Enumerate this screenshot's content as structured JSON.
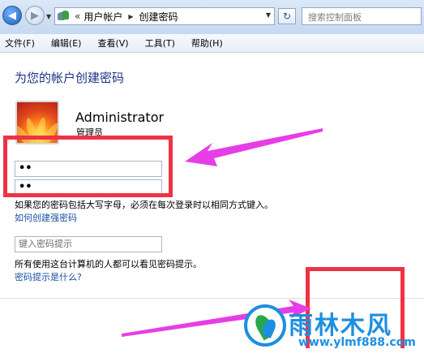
{
  "address_bar": {
    "breadcrumb_prefix": "«",
    "breadcrumb": [
      "用户帐户",
      "创建密码"
    ],
    "search_placeholder": "搜索控制面板"
  },
  "menu": [
    "文件(F)",
    "编辑(E)",
    "查看(V)",
    "工具(T)",
    "帮助(H)"
  ],
  "page": {
    "title": "为您的帐户创建密码",
    "user": {
      "name": "Administrator",
      "type": "管理员"
    },
    "password_field": "••",
    "confirm_field": "••",
    "case_note": "如果您的密码包括大写字母，必须在每次登录时以相同方式键入。",
    "strong_password_link": "如何创建强密码",
    "hint_placeholder": "键入密码提示",
    "hint_note": "所有使用这台计算机的人都可以看见密码提示。",
    "hint_link": "密码提示是什么?"
  },
  "annotation": {
    "highlight_color": "#ee3344",
    "arrow_color": "#e63ee6"
  },
  "watermark": {
    "title": "雨林木风",
    "url": "www.ylmf888.com",
    "color": "#1d8fe0"
  }
}
